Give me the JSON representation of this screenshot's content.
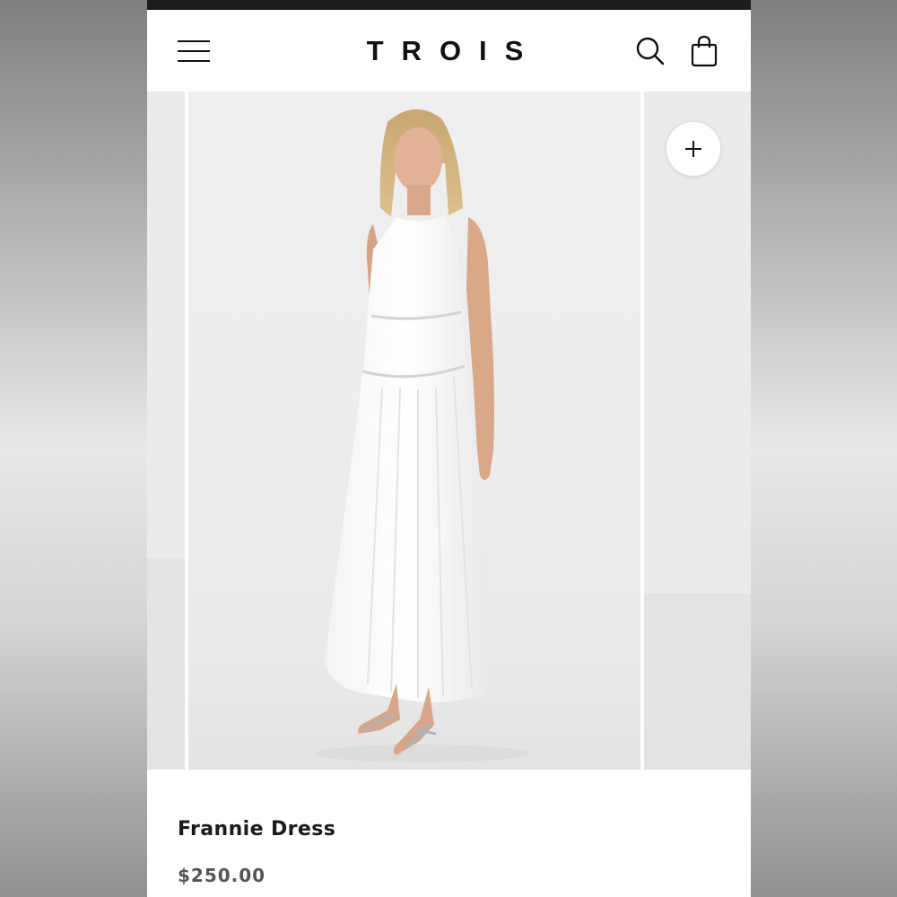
{
  "header": {
    "brand": "TROIS",
    "menu_icon": "hamburger-menu-icon",
    "search_icon": "search-icon",
    "bag_icon": "shopping-bag-icon"
  },
  "gallery": {
    "add_icon": "plus-icon"
  },
  "product": {
    "name": "Frannie Dress",
    "price": "$250.00"
  },
  "colors": {
    "text": "#111111",
    "price": "#555555",
    "photo_background": "#ececed"
  }
}
